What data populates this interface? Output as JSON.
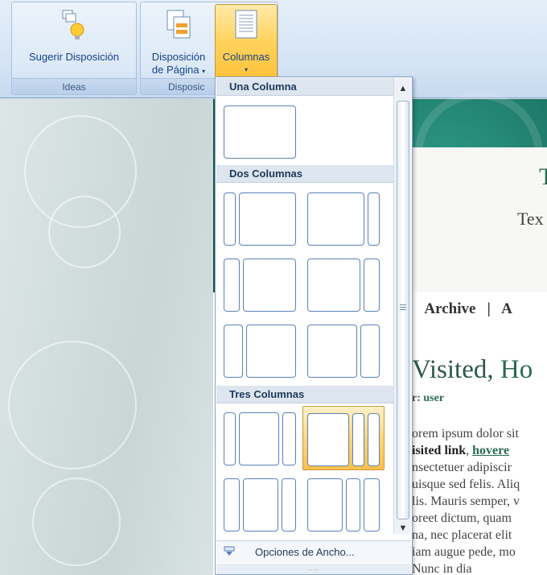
{
  "ribbon": {
    "groups": [
      {
        "label": "Ideas"
      },
      {
        "label": "Disposic"
      }
    ],
    "buttons": {
      "suggest": "Sugerir Disposición",
      "page_layout_line1": "Disposición",
      "page_layout_line2": "de Página",
      "columns": "Columnas"
    }
  },
  "gallery": {
    "sections": [
      {
        "title": "Una Columna"
      },
      {
        "title": "Dos Columnas"
      },
      {
        "title": "Tres Columnas"
      }
    ],
    "footer_label": "Opciones de Ancho...",
    "resize_grip": "....",
    "scroll_up": "▲",
    "scroll_down": "▼"
  },
  "document": {
    "header_partial_title": "T",
    "header_partial_sub": "Tex",
    "nav_sep_left": "|",
    "nav_archive": "Archive",
    "nav_sep_right": "|",
    "nav_cut": "A",
    "post_title_a": "Visited,",
    "post_title_b": "Ho",
    "author_prefix": "r:",
    "author_name": "user",
    "body_lines": [
      "orem ipsum dolor sit",
      "isited link",
      "hovere",
      "nsectetuer adipiscir",
      "uisque sed felis. Aliq",
      "lis. Mauris semper, v",
      "oreet dictum, quam",
      "na, nec placerat elit",
      "iam augue pede, mo",
      "  Nunc in dia"
    ]
  },
  "colors": {
    "accent_selected": "#ffd35e",
    "header_teal": "#17695b",
    "link_green": "#2a6a52"
  },
  "icons": [
    "suggest-layout-icon",
    "page-layout-icon",
    "columns-icon",
    "width-options-icon",
    "chevron-down-icon"
  ]
}
